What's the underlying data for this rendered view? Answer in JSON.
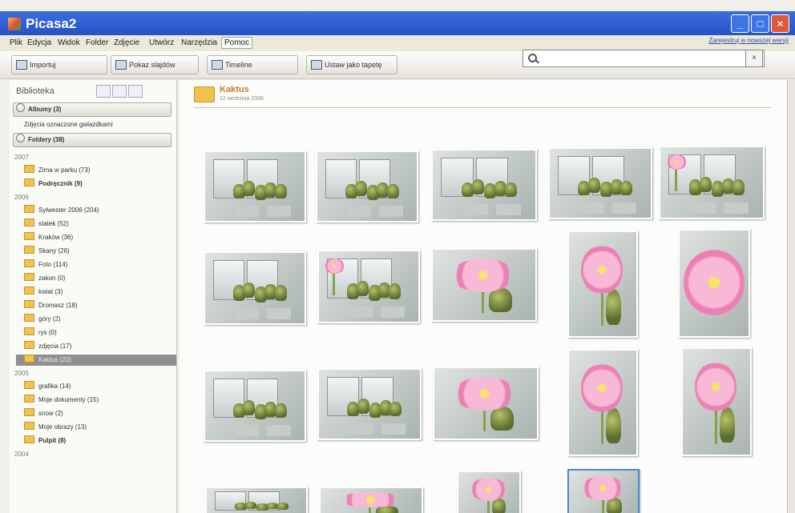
{
  "window": {
    "title": "Picasa2",
    "controls": {
      "minimize": "_",
      "maximize": "□",
      "close": "×"
    }
  },
  "menu": {
    "items": [
      "Plik",
      "Edycja",
      "Widok",
      "Folder",
      "Zdjęcie",
      "Utwórz",
      "Narzędzia",
      "Pomoc"
    ],
    "active_index": 7,
    "link": "Zarejestruj w nowszej wersji"
  },
  "toolbar": {
    "import": "Importuj",
    "slideshow": "Pokaz slajdów",
    "timeline": "Timeline",
    "button4": "Ustaw jako tapetę",
    "search_placeholder": "",
    "search_clear": "×"
  },
  "sidebar": {
    "header": "Biblioteka",
    "albums_label": "Albumy (3)",
    "albums_sub": "Zdjęcia oznaczone gwiazdkami",
    "folders_label": "Foldery (38)",
    "years": [
      "2007",
      "2006",
      "2005",
      "2004"
    ],
    "folders_2007": [
      {
        "name": "Zima w parku (73)",
        "bold": false
      },
      {
        "name": "Podręcznik (9)",
        "bold": true
      }
    ],
    "folders_2006": [
      {
        "name": "Sylwester 2006 (204)",
        "bold": false
      },
      {
        "name": "statek (52)",
        "bold": false
      },
      {
        "name": "Kraków (36)",
        "bold": false
      },
      {
        "name": "Skany (26)",
        "bold": false
      },
      {
        "name": "Foto (114)",
        "bold": false
      },
      {
        "name": "zakon (0)",
        "bold": false
      },
      {
        "name": "kwiat (3)",
        "bold": false
      },
      {
        "name": "Dromasz (18)",
        "bold": false
      },
      {
        "name": "góry (2)",
        "bold": false
      },
      {
        "name": "rys (0)",
        "bold": false
      },
      {
        "name": "zdjęcia (17)",
        "bold": false
      },
      {
        "name": "Kaktus (22)",
        "bold": false,
        "selected": true
      }
    ],
    "folders_2005": [
      {
        "name": "grafika (14)",
        "bold": false
      },
      {
        "name": "Moje dokumenty (15)",
        "bold": false
      },
      {
        "name": "snow (2)",
        "bold": false
      },
      {
        "name": "Moje obrazy (13)",
        "bold": false
      },
      {
        "name": "Pulpit (8)",
        "bold": true
      }
    ]
  },
  "main": {
    "folder_title": "Kaktus",
    "folder_date": "12 września 2006",
    "thumbnails": [
      {
        "kind": "window"
      },
      {
        "kind": "window"
      },
      {
        "kind": "window"
      },
      {
        "kind": "window"
      },
      {
        "kind": "bud"
      },
      {
        "kind": "window"
      },
      {
        "kind": "bud"
      },
      {
        "kind": "flower"
      },
      {
        "kind": "flower"
      },
      {
        "kind": "flower-big"
      },
      {
        "kind": "window"
      },
      {
        "kind": "window"
      },
      {
        "kind": "flower"
      },
      {
        "kind": "flower"
      },
      {
        "kind": "flower"
      },
      {
        "kind": "window"
      },
      {
        "kind": "flower"
      },
      {
        "kind": "flower"
      },
      {
        "kind": "flower",
        "selected": true
      }
    ]
  }
}
